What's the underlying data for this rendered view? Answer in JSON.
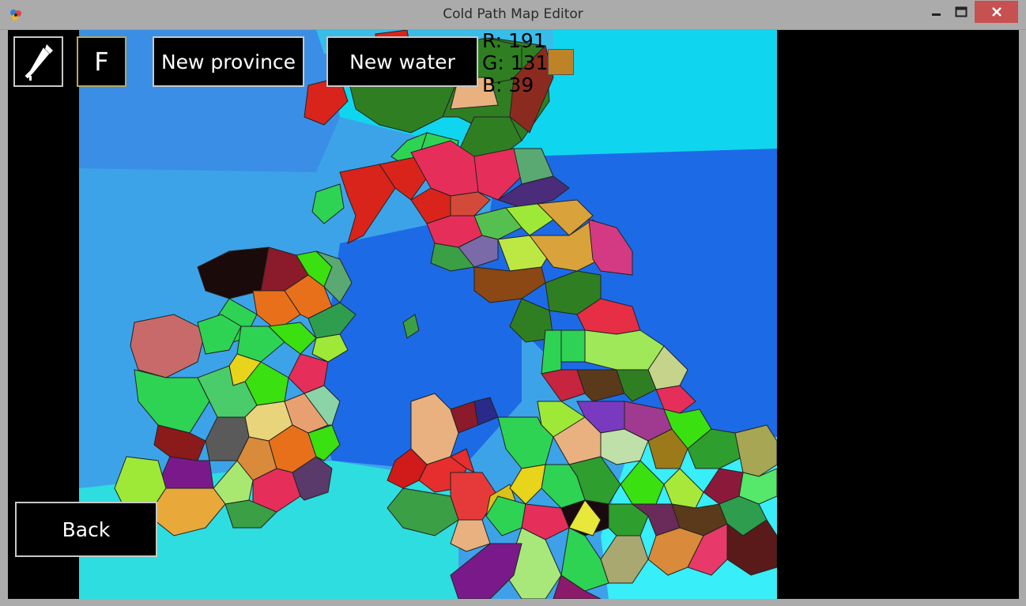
{
  "window": {
    "title": "Cold Path Map Editor"
  },
  "toolbar": {
    "eyedropper_icon": "eyedropper-icon",
    "f_label": "F",
    "new_province_label": "New province",
    "new_water_label": "New water",
    "back_label": "Back"
  },
  "color_picker": {
    "r_text": "R: 191",
    "g_text": "G: 131",
    "b_text": "B: 39",
    "swatch_color": "#bf8327"
  },
  "colors": {
    "close_button": "#c75050",
    "chrome": "#ababab"
  }
}
